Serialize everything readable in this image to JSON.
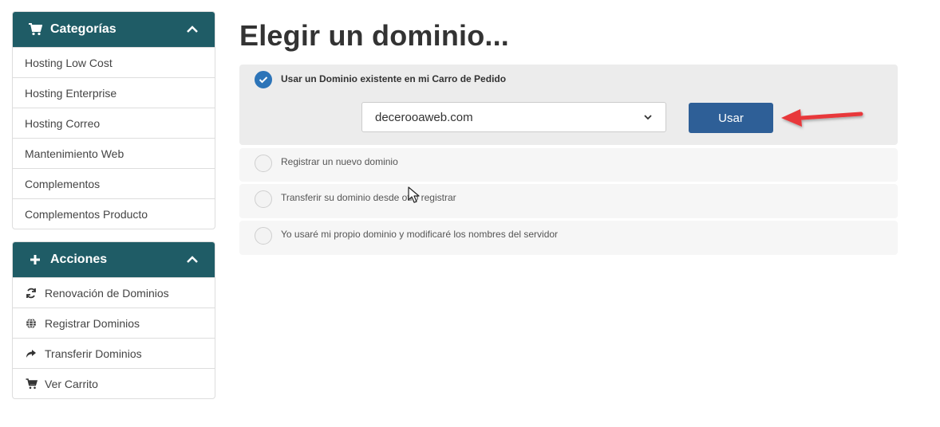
{
  "sidebar": {
    "categories": {
      "title": "Categorías",
      "items": [
        "Hosting Low Cost",
        "Hosting Enterprise",
        "Hosting Correo",
        "Mantenimiento Web",
        "Complementos",
        "Complementos Producto"
      ]
    },
    "actions": {
      "title": "Acciones",
      "items": [
        {
          "label": "Renovación de Dominios",
          "icon": "refresh-icon"
        },
        {
          "label": "Registrar Dominios",
          "icon": "globe-icon"
        },
        {
          "label": "Transferir Dominios",
          "icon": "share-arrow-icon"
        },
        {
          "label": "Ver Carrito",
          "icon": "cart-icon"
        }
      ]
    }
  },
  "main": {
    "title": "Elegir un dominio...",
    "options": {
      "existing": "Usar un Dominio existente en mi Carro de Pedido",
      "register": "Registrar un nuevo dominio",
      "transfer": "Transferir su dominio desde otro registrar",
      "own": "Yo usaré mi propio dominio y modificaré los nombres del servidor"
    },
    "domain_select_value": "decerooaweb.com",
    "use_button": "Usar"
  },
  "colors": {
    "panel_header": "#1f5c66",
    "button": "#2e5f97",
    "radio_checked": "#2c74b8",
    "annotation_arrow": "#e8393a"
  }
}
